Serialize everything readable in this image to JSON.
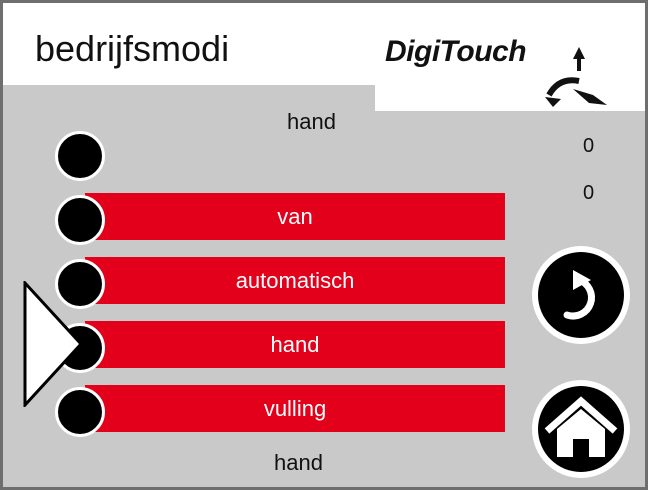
{
  "header": {
    "title": "bedrijfsmodi",
    "logo_text": "DigiTouch"
  },
  "status": {
    "current_mode_top": "hand",
    "current_mode_bottom": "hand",
    "value_1": "0",
    "value_2": "0"
  },
  "modes": [
    {
      "label": "van"
    },
    {
      "label": "automatisch"
    },
    {
      "label": "hand"
    },
    {
      "label": "vulling"
    }
  ],
  "selected_mode": "hand",
  "icons": {
    "back": "back-arrow-icon",
    "home": "home-icon",
    "pointer": "selection-pointer-icon"
  },
  "colors": {
    "accent": "#e2001a",
    "background": "#c9c9c9",
    "header": "#ffffff"
  }
}
